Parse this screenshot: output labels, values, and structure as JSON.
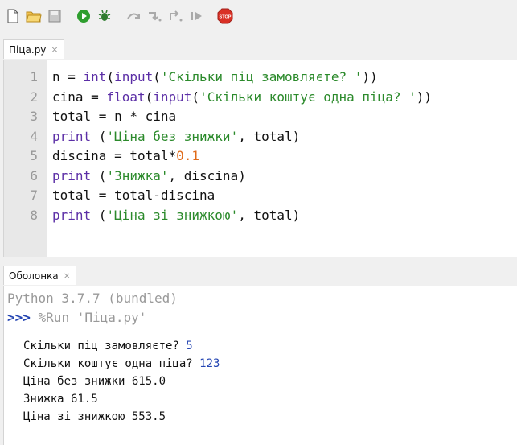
{
  "toolbar": {
    "buttons": [
      {
        "name": "new-file",
        "icon": "new-file-icon"
      },
      {
        "name": "open-file",
        "icon": "open-folder-icon"
      },
      {
        "name": "save-file",
        "icon": "save-icon"
      },
      {
        "name": "run",
        "icon": "run-icon"
      },
      {
        "name": "debug",
        "icon": "bug-icon"
      },
      {
        "name": "step-over",
        "icon": "step-over-icon"
      },
      {
        "name": "step-into",
        "icon": "step-into-icon"
      },
      {
        "name": "step-out",
        "icon": "step-out-icon"
      },
      {
        "name": "resume",
        "icon": "resume-icon"
      },
      {
        "name": "stop",
        "icon": "stop-icon",
        "label": "STOP"
      }
    ],
    "colors": {
      "run": "#2e9e2e",
      "stop": "#d93025"
    }
  },
  "editor": {
    "tab_label": "Піца.py",
    "tab_close": "×",
    "lines": [
      {
        "n": "1",
        "parts": [
          [
            "",
            "n = "
          ],
          [
            "kw",
            "int"
          ],
          [
            "",
            "("
          ],
          [
            "kw",
            "input"
          ],
          [
            "",
            "("
          ],
          [
            "str",
            "'Скільки піц замовляєте? '"
          ],
          [
            "",
            "))"
          ]
        ]
      },
      {
        "n": "2",
        "parts": [
          [
            "",
            "cina = "
          ],
          [
            "kw",
            "float"
          ],
          [
            "",
            "("
          ],
          [
            "kw",
            "input"
          ],
          [
            "",
            "("
          ],
          [
            "str",
            "'Скільки коштує одна піца? '"
          ],
          [
            "",
            "))"
          ]
        ]
      },
      {
        "n": "3",
        "parts": [
          [
            "",
            "total = n * cina"
          ]
        ]
      },
      {
        "n": "4",
        "parts": [
          [
            "kw",
            "print"
          ],
          [
            "",
            " ("
          ],
          [
            "str",
            "'Ціна без знижки'"
          ],
          [
            "",
            ", total)"
          ]
        ]
      },
      {
        "n": "5",
        "parts": [
          [
            "",
            "discina = total*"
          ],
          [
            "num",
            "0.1"
          ]
        ]
      },
      {
        "n": "6",
        "parts": [
          [
            "kw",
            "print"
          ],
          [
            "",
            " ("
          ],
          [
            "str",
            "'Знижка'"
          ],
          [
            "",
            ", discina)"
          ]
        ]
      },
      {
        "n": "7",
        "parts": [
          [
            "",
            "total = total-discina"
          ]
        ]
      },
      {
        "n": "8",
        "parts": [
          [
            "kw",
            "print"
          ],
          [
            "",
            " ("
          ],
          [
            "str",
            "'Ціна зі знижкою'"
          ],
          [
            "",
            ", total)"
          ]
        ]
      }
    ]
  },
  "shell": {
    "tab_label": "Оболонка",
    "tab_close": "×",
    "banner": "Python 3.7.7 (bundled)",
    "prompt": ">>>",
    "command": " %Run 'Піца.py'",
    "output": [
      {
        "text": "Скільки піц замовляєте? ",
        "input": "5"
      },
      {
        "text": "Скільки коштує одна піца? ",
        "input": "123"
      },
      {
        "text": "Ціна без знижки 615.0",
        "input": ""
      },
      {
        "text": "Знижка 61.5",
        "input": ""
      },
      {
        "text": "Ціна зі знижкою 553.5",
        "input": ""
      }
    ]
  }
}
